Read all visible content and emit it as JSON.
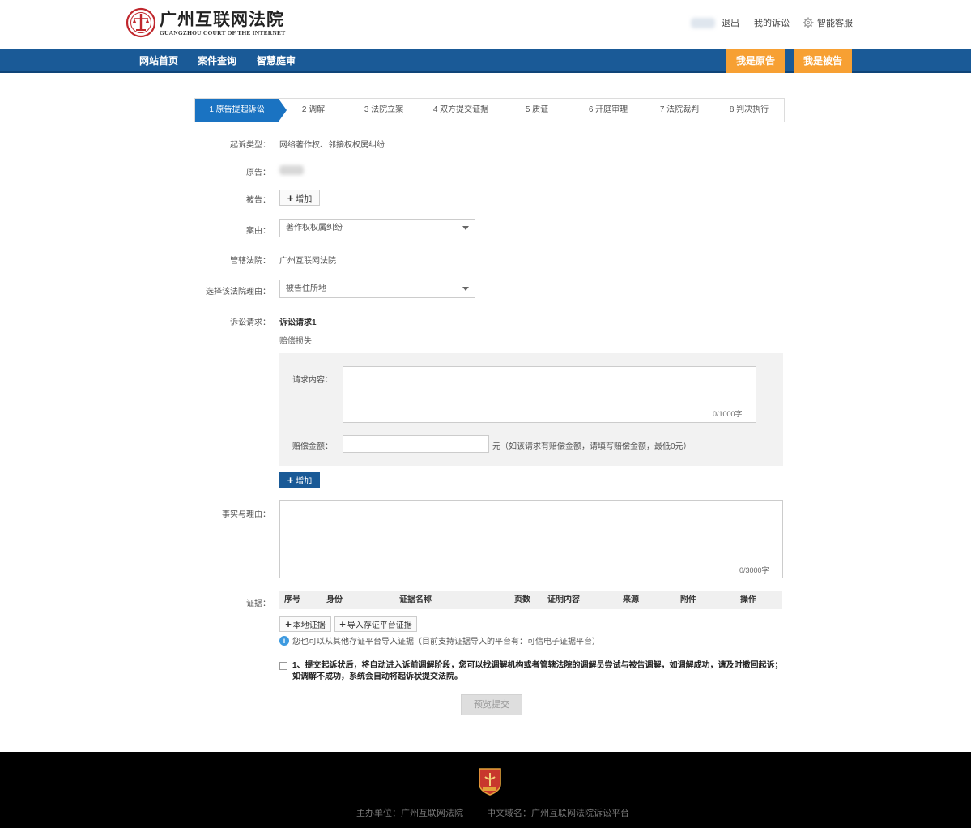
{
  "header": {
    "logo_cn": "广州互联网法院",
    "logo_en": "GUANGZHOU COURT OF THE INTERNET",
    "logout": "退出",
    "my_cases": "我的诉讼",
    "service": "智能客服"
  },
  "nav": {
    "items": [
      "网站首页",
      "案件查询",
      "智慧庭审"
    ],
    "plaintiff": "我是原告",
    "defendant": "我是被告"
  },
  "steps": [
    "1 原告提起诉讼",
    "2 调解",
    "3 法院立案",
    "4 双方提交证据",
    "5 质证",
    "6 开庭审理",
    "7 法院裁判",
    "8 判决执行"
  ],
  "form": {
    "suit_type_label": "起诉类型：",
    "suit_type_value": "网络著作权、邻接权权属纠纷",
    "plaintiff_label": "原告：",
    "defendant_label": "被告：",
    "add_label": "增加",
    "cause_label": "案由：",
    "cause_value": "著作权权属纠纷",
    "court_label": "管辖法院：",
    "court_value": "广州互联网法院",
    "reason_label": "选择该法院理由：",
    "reason_value": "被告住所地",
    "claim_label": "诉讼请求：",
    "claim_title": "诉讼请求1",
    "claim_sub": "赔偿损失",
    "request_content_label": "请求内容：",
    "request_counter": "0/1000字",
    "amount_label": "赔偿金额：",
    "amount_hint": "元（如该请求有赔偿金额，请填写赔偿金额，最低0元）",
    "add_claim_label": "增加",
    "facts_label": "事实与理由：",
    "facts_counter": "0/3000字",
    "evidence_label": "证据：",
    "evidence_columns": [
      "序号",
      "身份",
      "证据名称",
      "页数",
      "证明内容",
      "来源",
      "附件",
      "操作"
    ],
    "local_evidence": "本地证据",
    "import_evidence": "导入存证平台证据",
    "info_text": "您也可以从其他存证平台导入证据（目前支持证据导入的平台有：可信电子证据平台）",
    "agreement": "1、提交起诉状后，将自动进入诉前调解阶段，您可以找调解机构或者管辖法院的调解员尝试与被告调解，如调解成功，请及时撤回起诉；如调解不成功，系统会自动将起诉状提交法院。",
    "submit": "预览提交"
  },
  "footer": {
    "host": "主办单位：广州互联网法院",
    "domain": "中文域名：广州互联网法院诉讼平台"
  },
  "colors": {
    "nav_bg": "#1a5a97",
    "role_button": "#f7a033",
    "active_step": "#1a73c2"
  }
}
